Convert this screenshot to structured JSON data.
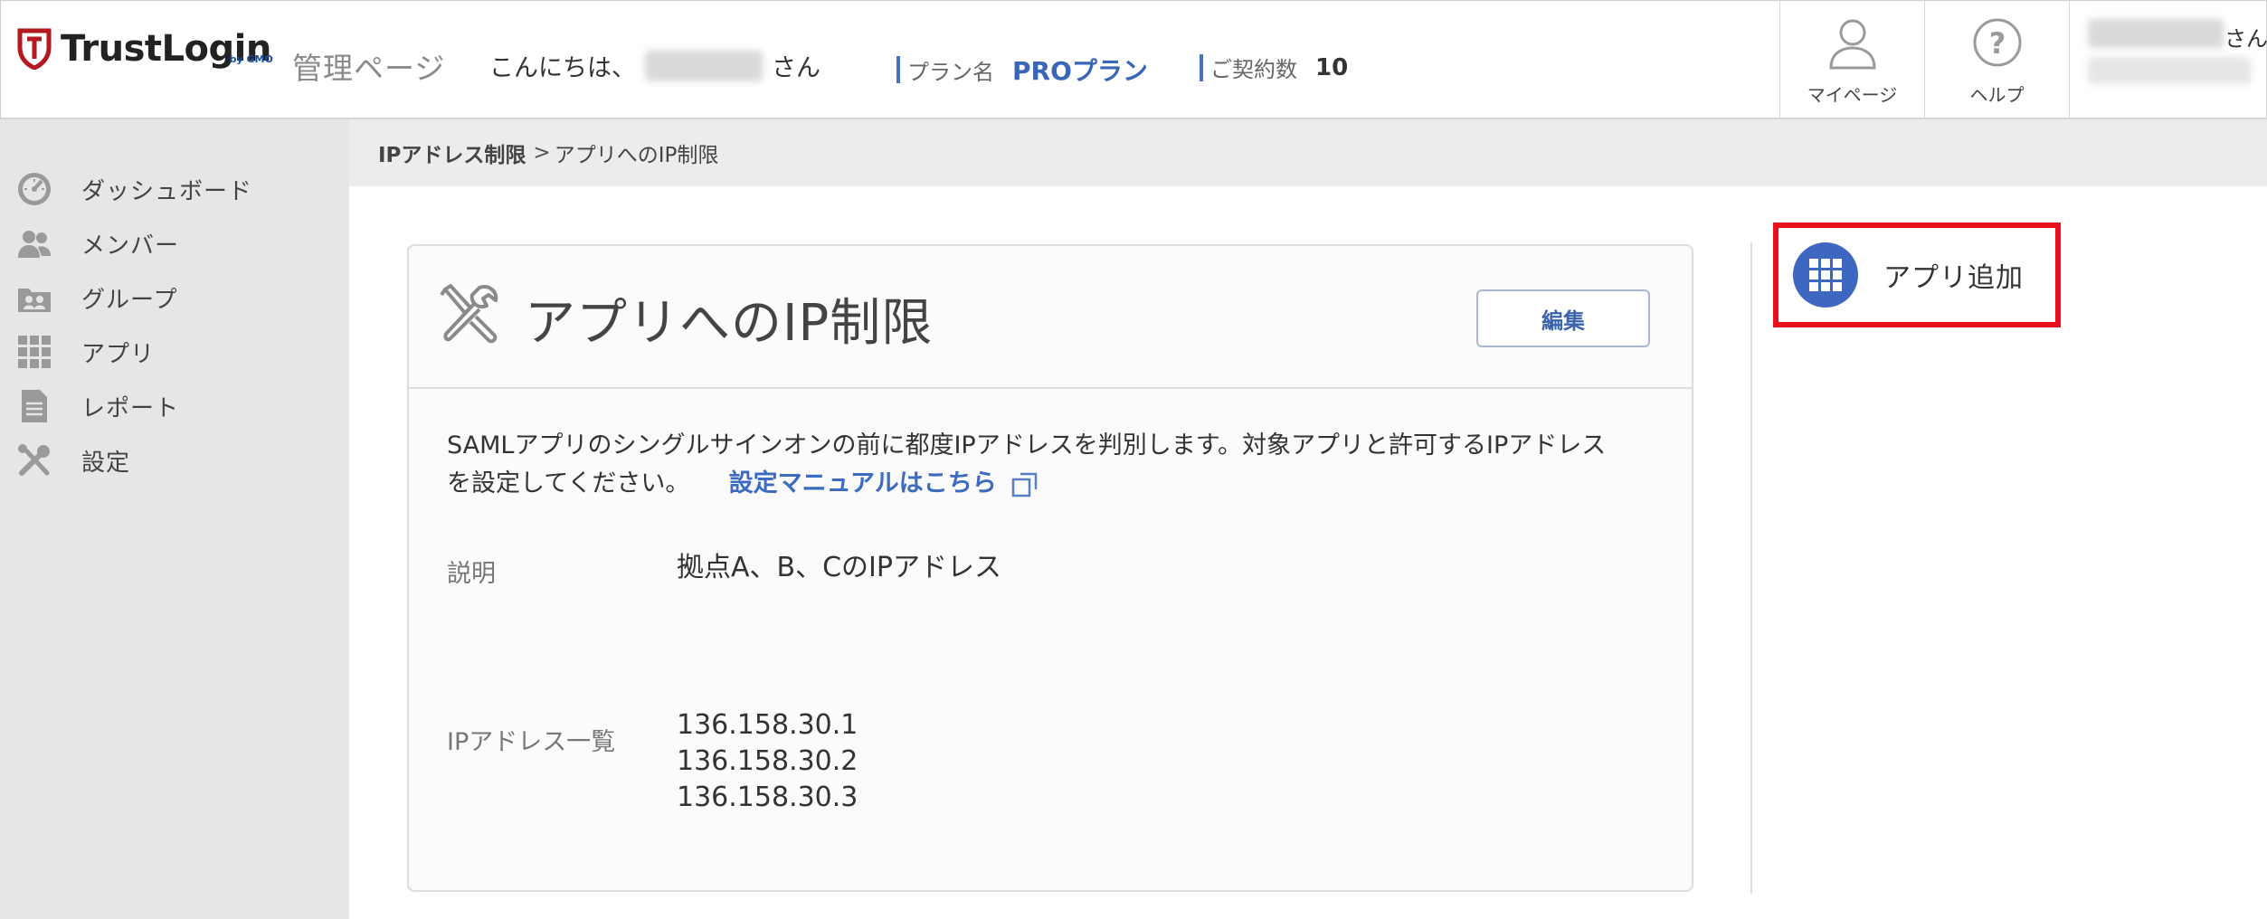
{
  "header": {
    "logo_text": "TrustLogin",
    "logo_sub": "by GMO",
    "admin_title": "管理ページ",
    "greeting_prefix": "こんにちは、",
    "greeting_suffix": "さん",
    "plan_label": "プラン名",
    "plan_value": "PROプラン",
    "contract_label": "ご契約数",
    "contract_value": "10",
    "mypage_label": "マイページ",
    "help_label": "ヘルプ",
    "user_suffix": "さん"
  },
  "sidebar": {
    "items": [
      {
        "label": "ダッシュボード",
        "icon": "dashboard-icon"
      },
      {
        "label": "メンバー",
        "icon": "members-icon"
      },
      {
        "label": "グループ",
        "icon": "group-icon"
      },
      {
        "label": "アプリ",
        "icon": "apps-grid-icon"
      },
      {
        "label": "レポート",
        "icon": "report-icon"
      },
      {
        "label": "設定",
        "icon": "settings-tools-icon"
      }
    ]
  },
  "breadcrumb": {
    "parent": "IPアドレス制限",
    "separator": ">",
    "current": "アプリへのIP制限"
  },
  "card": {
    "title": "アプリへのIP制限",
    "edit_label": "編集",
    "description_line1": "SAMLアプリのシングルサインオンの前に都度IPアドレスを判別します。対象アプリと許可するIPアドレス",
    "description_line2": "を設定してください。",
    "manual_link": "設定マニュアルはこちら",
    "desc_label": "説明",
    "desc_value": "拠点A、B、CのIPアドレス",
    "ip_label": "IPアドレス一覧",
    "ip_list": [
      "136.158.30.1",
      "136.158.30.2",
      "136.158.30.3"
    ]
  },
  "side_action": {
    "add_app_label": "アプリ追加"
  },
  "colors": {
    "accent": "#3d67c0",
    "highlight": "#e8101a",
    "sidebar_bg": "#e6e6e6"
  }
}
